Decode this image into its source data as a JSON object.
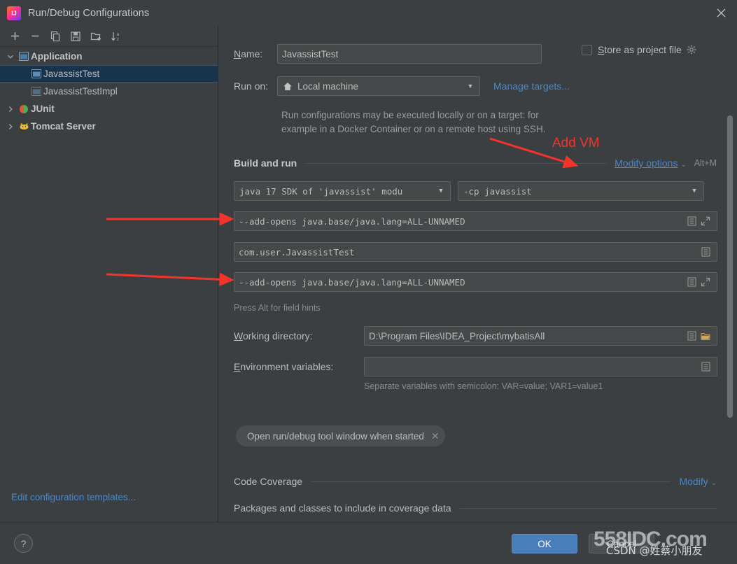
{
  "window": {
    "title": "Run/Debug Configurations",
    "app_icon": "intellij-idea-icon",
    "close_icon": "close-icon"
  },
  "tree_toolbar": {
    "buttons": [
      {
        "name": "add-configuration-button",
        "icon": "plus-icon"
      },
      {
        "name": "remove-configuration-button",
        "icon": "minus-icon"
      },
      {
        "name": "copy-configuration-button",
        "icon": "copy-icon"
      },
      {
        "name": "save-configuration-button",
        "icon": "save-icon"
      },
      {
        "name": "move-to-folder-button",
        "icon": "folder-add-icon"
      },
      {
        "name": "sort-configurations-button",
        "icon": "sort-alphabetical-icon"
      }
    ]
  },
  "sidebar": {
    "items": [
      {
        "label": "Application",
        "icon": "application-icon",
        "twisty": "expanded",
        "level": 0,
        "selected": false
      },
      {
        "label": "JavassistTest",
        "icon": "application-icon",
        "twisty": "none",
        "level": 1,
        "selected": true
      },
      {
        "label": "JavassistTestImpl",
        "icon": "application-icon",
        "twisty": "none",
        "level": 1,
        "selected": false
      },
      {
        "label": "JUnit",
        "icon": "junit-icon",
        "twisty": "collapsed",
        "level": 0,
        "selected": false
      },
      {
        "label": "Tomcat Server",
        "icon": "tomcat-icon",
        "twisty": "collapsed",
        "level": 0,
        "selected": false
      }
    ],
    "edit_templates_link": "Edit configuration templates..."
  },
  "form": {
    "name_label": "Name:",
    "name_value": "JavassistTest",
    "store_as_project_file_label": "Store as project file",
    "store_as_project_file_checked": false,
    "store_gear_icon": "gear-icon",
    "run_on_label": "Run on:",
    "run_on_value": "Local machine",
    "run_on_icon": "home-icon",
    "manage_targets_link": "Manage targets...",
    "description_line1": "Run configurations may be executed locally or on a target: for",
    "description_line2": "example in a Docker Container or on a remote host using SSH.",
    "build_and_run_title": "Build and run",
    "modify_options_link": "Modify options",
    "modify_options_shortcut": "Alt+M",
    "jre_value": "java 17 SDK of 'javassist' modu",
    "classpath_value": "-cp javassist",
    "vm_options_value": "--add-opens java.base/java.lang=ALL-UNNAMED",
    "main_class_value": "com.user.JavassistTest",
    "program_arguments_value": "--add-opens java.base/java.lang=ALL-UNNAMED",
    "field_hints_text": "Press Alt for field hints",
    "working_directory_label": "Working directory:",
    "working_directory_value": "D:\\Program Files\\IDEA_Project\\mybatisAll",
    "environment_variables_label": "Environment variables:",
    "environment_variables_value": "",
    "environment_hint": "Separate variables with semicolon: VAR=value; VAR1=value1",
    "open_tool_window_chip": "Open run/debug tool window when started",
    "chip_close_icon": "close-icon",
    "code_coverage_title": "Code Coverage",
    "code_coverage_modify_link": "Modify",
    "coverage_packages_title": "Packages and classes to include in coverage data",
    "macro_icon": "macro-list-icon",
    "expand_icon": "expand-editor-icon",
    "browse_icon": "folder-browse-icon"
  },
  "footer": {
    "help_label": "?",
    "ok_label": "OK",
    "cancel_label": "Cancel"
  },
  "annotations": [
    {
      "name": "add-vm-annotation",
      "text": "Add VM"
    }
  ],
  "watermarks": {
    "site": "558IDC.com",
    "author": "CSDN @姓蔡小朋友"
  },
  "colors": {
    "accent_link": "#4a88c7",
    "selection": "#18344c",
    "annotation_red": "#f2342c",
    "ok_button": "#4a7ebb",
    "panel_bg": "#3c3f41",
    "field_bg": "#45494a"
  }
}
